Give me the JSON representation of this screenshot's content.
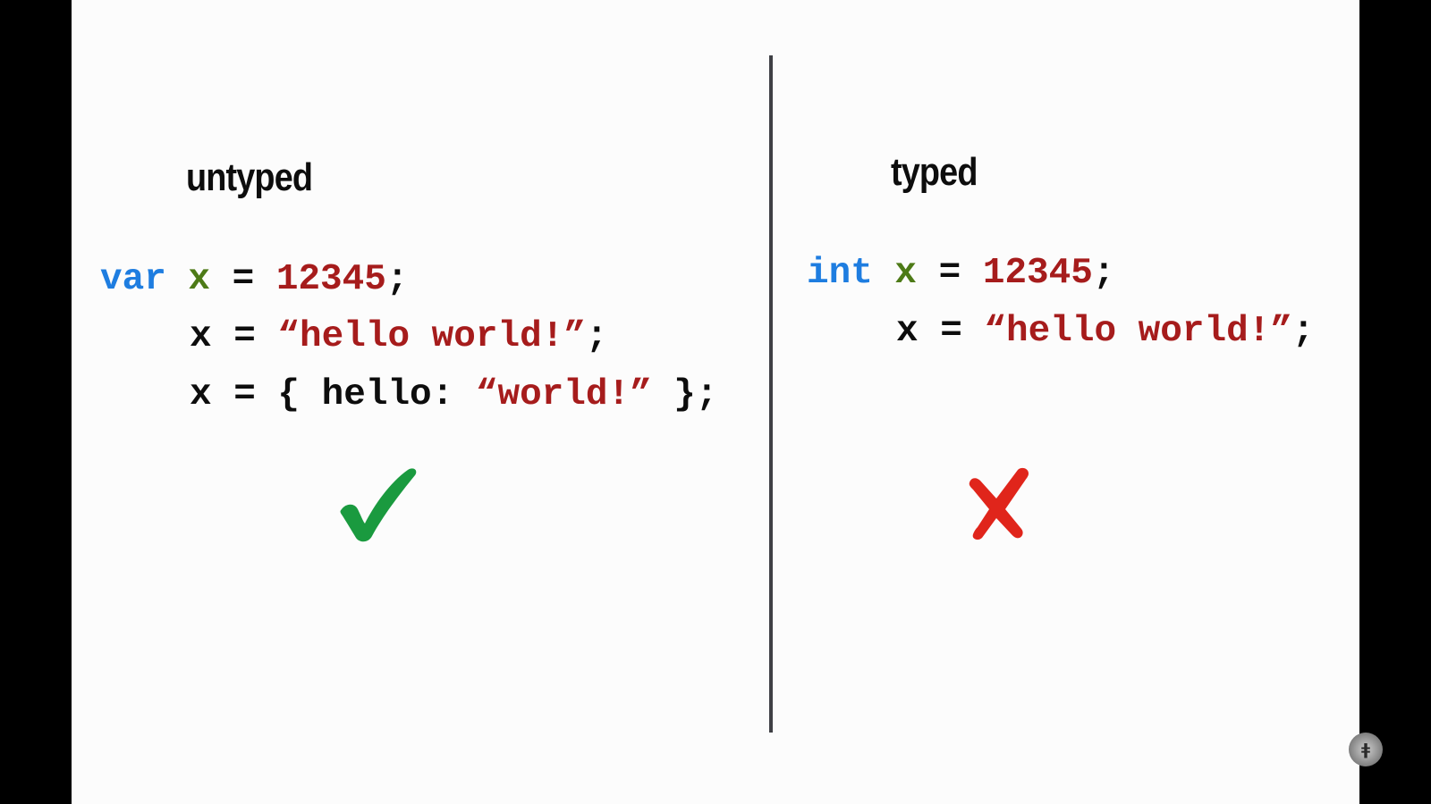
{
  "slide": {
    "left_heading": "untyped",
    "right_heading": "typed",
    "left_code": [
      [
        {
          "text": "var",
          "role": "keyword"
        },
        {
          "text": " ",
          "role": "plain"
        },
        {
          "text": "x",
          "role": "variable"
        },
        {
          "text": " = ",
          "role": "plain"
        },
        {
          "text": "12345",
          "role": "literal"
        },
        {
          "text": ";",
          "role": "plain"
        }
      ],
      [
        {
          "text": "x",
          "role": "plain"
        },
        {
          "text": " = ",
          "role": "plain"
        },
        {
          "text": "“hello world!”",
          "role": "literal"
        },
        {
          "text": ";",
          "role": "plain"
        }
      ],
      [
        {
          "text": "x",
          "role": "plain"
        },
        {
          "text": " = { hello: ",
          "role": "plain"
        },
        {
          "text": "“world!”",
          "role": "literal"
        },
        {
          "text": " };",
          "role": "plain"
        }
      ]
    ],
    "right_code": [
      [
        {
          "text": "int",
          "role": "keyword"
        },
        {
          "text": " ",
          "role": "plain"
        },
        {
          "text": "x",
          "role": "variable"
        },
        {
          "text": " = ",
          "role": "plain"
        },
        {
          "text": "12345",
          "role": "literal"
        },
        {
          "text": ";",
          "role": "plain"
        }
      ],
      [
        {
          "text": "x",
          "role": "plain"
        },
        {
          "text": " = ",
          "role": "plain"
        },
        {
          "text": "“hello world!”",
          "role": "literal"
        },
        {
          "text": ";",
          "role": "plain"
        }
      ]
    ],
    "left_result_icon": "checkmark-icon",
    "right_result_icon": "cross-icon",
    "watermark_glyph": "ǂ"
  },
  "colors": {
    "background": "#fcfcfc",
    "letterbox": "#000000",
    "divider": "#3f4045",
    "keyword": "#1e7de0",
    "variable": "#4d7a17",
    "literal": "#a61c1c",
    "plain": "#0d0d0d",
    "check": "#1a9a3f",
    "cross": "#e0251b"
  }
}
